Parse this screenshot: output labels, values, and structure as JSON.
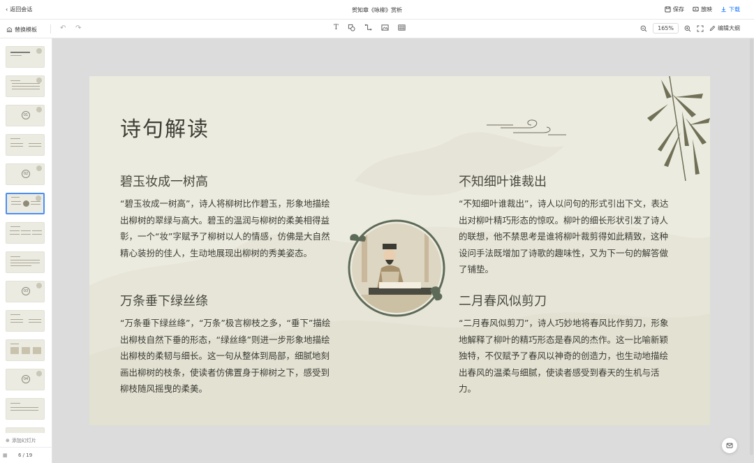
{
  "topbar": {
    "back_label": "返回会话",
    "title": "贺知章《咏柳》赏析",
    "save_label": "保存",
    "play_label": "放映",
    "download_label": "下载"
  },
  "toolbar": {
    "replace_template_label": "替换模板",
    "zoom": "165%",
    "edit_outline_label": "编辑大纲"
  },
  "sidebar": {
    "add_slide_label": "添加幻灯片",
    "page_indicator": "6 / 19",
    "thumb_numbers": [
      "01",
      "02",
      "03",
      "04"
    ]
  },
  "slide": {
    "title": "诗句解读",
    "sections": [
      {
        "heading": "碧玉妆成一树高",
        "body": "“碧玉妆成一树高”，诗人将柳树比作碧玉，形象地描绘出柳树的翠绿与高大。碧玉的温润与柳树的柔美相得益彰，一个“妆”字赋予了柳树以人的情感，仿佛是大自然精心装扮的佳人，生动地展现出柳树的秀美姿态。"
      },
      {
        "heading": "万条垂下绿丝绦",
        "body": "“万条垂下绿丝绦”，“万条”极言柳枝之多，“垂下”描绘出柳枝自然下垂的形态，“绿丝绦”则进一步形象地描绘出柳枝的柔韧与细长。这一句从整体到局部，细腻地刻画出柳树的枝条，使读者仿佛置身于柳树之下，感受到柳枝随风摇曳的柔美。"
      },
      {
        "heading": "不知细叶谁裁出",
        "body": "“不知细叶谁裁出”，诗人以问句的形式引出下文，表达出对柳叶精巧形态的惊叹。柳叶的细长形状引发了诗人的联想，他不禁思考是谁将柳叶裁剪得如此精致，这种设问手法既增加了诗歌的趣味性，又为下一句的解答做了铺垫。"
      },
      {
        "heading": "二月春风似剪刀",
        "body": "“二月春风似剪刀”，诗人巧妙地将春风比作剪刀，形象地解释了柳叶的精巧形态是春风的杰作。这一比喻新颖独特，不仅赋予了春风以神奇的创造力，也生动地描绘出春风的温柔与细腻，使读者感受到春天的生机与活力。"
      }
    ]
  }
}
